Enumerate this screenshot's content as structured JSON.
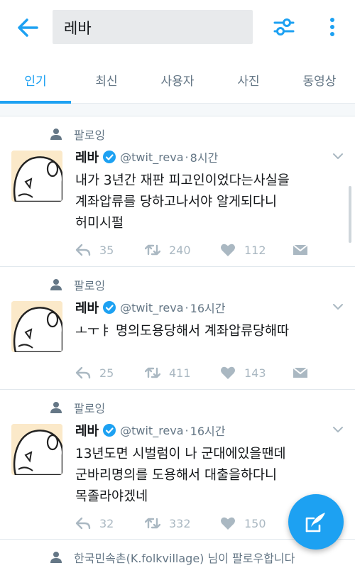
{
  "search": {
    "query": "레바"
  },
  "tabs": [
    {
      "label": "인기",
      "active": true
    },
    {
      "label": "최신",
      "active": false
    },
    {
      "label": "사용자",
      "active": false
    },
    {
      "label": "사진",
      "active": false
    },
    {
      "label": "동영상",
      "active": false
    }
  ],
  "colors": {
    "accent": "#1da1f2",
    "muted": "#657786",
    "action": "#aab8c2"
  },
  "tweets": [
    {
      "context": "팔로잉",
      "name": "레바",
      "handle": "@twit_reva",
      "time": "8시간",
      "text_lines": [
        "내가 3년간 재판 피고인이었다는사실을",
        "계좌압류를 당하고나서야 알게되다니",
        "허미시펄"
      ],
      "replies": "35",
      "retweets": "240",
      "likes": "112"
    },
    {
      "context": "팔로잉",
      "name": "레바",
      "handle": "@twit_reva",
      "time": "16시간",
      "text_lines": [
        "ㅗㅜㅑ 명의도용당해서 계좌압류당해따"
      ],
      "replies": "25",
      "retweets": "411",
      "likes": "143"
    },
    {
      "context": "팔로잉",
      "name": "레바",
      "handle": "@twit_reva",
      "time": "16시간",
      "text_lines": [
        "13년도면 시벌럼이 나 군대에있을땐데",
        "군바리명의를 도용해서 대출을하다니",
        "목졸라야겠네"
      ],
      "replies": "32",
      "retweets": "332",
      "likes": "150"
    }
  ],
  "last_context": "한국민속촌(K.folkvillage) 님이 팔로우합니다",
  "icons": {
    "back": "arrow-left-icon",
    "filter": "sliders-icon",
    "more": "more-vertical-icon",
    "compose": "compose-icon"
  }
}
